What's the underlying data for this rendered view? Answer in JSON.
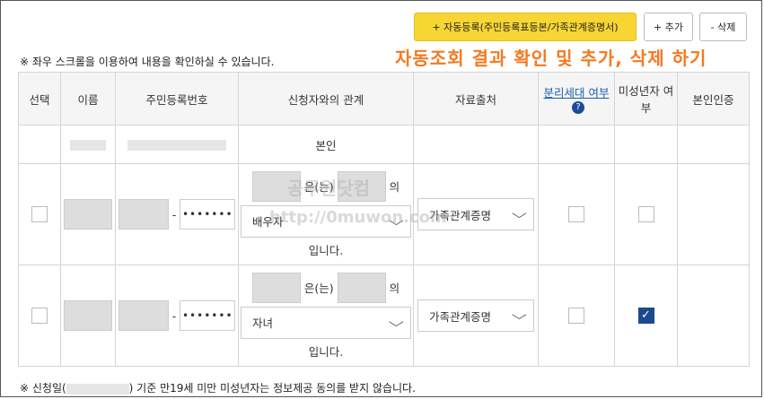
{
  "buttons": {
    "auto_register": "+ 자동등록(주민등록표등본/가족관계증명서)",
    "add": "+ 추가",
    "delete": "- 삭제"
  },
  "scroll_note": "※ 좌우 스크롤을 이용하여 내용을 확인하실 수 있습니다.",
  "overlay_text": "자동조회 결과 확인 및 추가, 삭제 하기",
  "table": {
    "headers": [
      "선택",
      "이름",
      "주민등록번호",
      "신청자와의 관계",
      "자료출처",
      "분리세대 여부",
      "미성년자 여부",
      "본인인증"
    ],
    "row1": {
      "relation": "본인"
    },
    "row2": {
      "masked_rrn": "•••••••",
      "connector_eun": "은(는)",
      "connector_ui": "의",
      "relation_select": "배우자",
      "suffix": "입니다.",
      "source_select": "가족관계증명",
      "separated": false,
      "minor": false
    },
    "row3": {
      "masked_rrn": "•••••••",
      "connector_eun": "은(는)",
      "connector_ui": "의",
      "relation_select": "자녀",
      "suffix": "입니다.",
      "source_select": "가족관계증명",
      "separated": false,
      "minor": true
    }
  },
  "footer_note_prefix": "※ 신청일(",
  "footer_note_suffix": ") 기준 만19세 미만 미성년자는 정보제공 동의를 받지 않습니다.",
  "watermark": {
    "line1": "공무원닷컴",
    "line2": "http://0muwon.com"
  },
  "colors": {
    "auto_button": "#f7d533",
    "overlay": "#f37a21",
    "check": "#1d4a8f"
  }
}
